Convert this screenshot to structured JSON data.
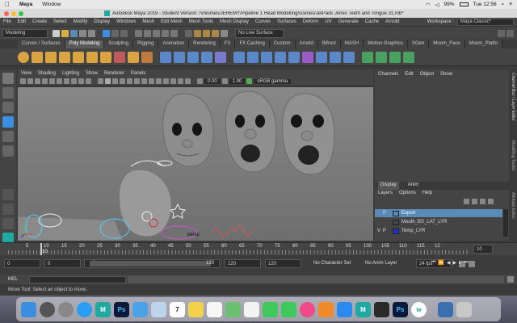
{
  "mac_menubar": {
    "apple": "",
    "app": "Maya",
    "window": "Window",
    "status_pct": "99%",
    "clock": "Tue 12:56"
  },
  "titlebar": {
    "title": "Autodesk Maya 2019 - Student Version: /Volumes/JEREMY/Pipeline 1 Head Modelling/scenes/JetPack Jones Teeth and Tongue 31.mb*"
  },
  "maya_menu": [
    "File",
    "Edit",
    "Create",
    "Select",
    "Modify",
    "Display",
    "Windows",
    "Mesh",
    "Edit Mesh",
    "Mesh Tools",
    "Mesh Display",
    "Curves",
    "Surfaces",
    "Deform",
    "UV",
    "Generate",
    "Cache",
    "Arnold"
  ],
  "workspace": {
    "label": "Workspace :",
    "value": "Maya Classic*"
  },
  "statusline": {
    "mode": "Modeling",
    "live_surface": "No Live Surface"
  },
  "shelf_tabs": [
    "Curves / Surfaces",
    "Poly Modeling",
    "Sculpting",
    "Rigging",
    "Animation",
    "Rendering",
    "FX",
    "FX Caching",
    "Custom",
    "Arnold",
    "Bifrost",
    "MASH",
    "Motion Graphics",
    "XGen",
    "Moom_Face",
    "Moom_Platfo"
  ],
  "active_shelf": "Poly Modeling",
  "panel_menu": [
    "View",
    "Shading",
    "Lighting",
    "Show",
    "Renderer",
    "Panels"
  ],
  "panel_toolbar": {
    "val1": "0.00",
    "val2": "1.00",
    "colorspace": "sRGB gamma"
  },
  "viewport": {
    "camera": "persp"
  },
  "channel_box": {
    "menu": [
      "Channels",
      "Edit",
      "Object",
      "Show"
    ]
  },
  "vert_tabs": {
    "tab1": "Channel Box / Layer Editor",
    "tab2": "Modelling Toolkit",
    "tab3": "Attribute Editor"
  },
  "layer_editor": {
    "tabs": [
      "Display",
      "Anim"
    ],
    "menu": [
      "Layers",
      "Options",
      "Help"
    ],
    "layers": [
      {
        "v": "",
        "p": "P",
        "name": "Export",
        "color": "#5a8ab8"
      },
      {
        "v": "",
        "p": "",
        "name": "Mouth_BS_LAT_LYR",
        "color": "#444444"
      },
      {
        "v": "V",
        "p": "P",
        "name": "Temp_LYR",
        "color": "#1a33cc"
      }
    ]
  },
  "timeslider": {
    "ticks": [
      "5",
      "10",
      "15",
      "20",
      "25",
      "30",
      "35",
      "40",
      "45",
      "50",
      "55",
      "60",
      "65",
      "70",
      "75",
      "80",
      "85",
      "90",
      "95",
      "100",
      "105",
      "110",
      "115",
      "12"
    ],
    "current_frame": "10",
    "current_marker": "10"
  },
  "rangeslider": {
    "start": "0",
    "start2": "0",
    "range_start": "0",
    "range_end": "120",
    "end": "120",
    "end2": "120",
    "character_set": "No Character Set",
    "anim_layer": "No Anim Layer",
    "fps": "24 fps"
  },
  "cmdline": {
    "label": "MEL"
  },
  "helpline": {
    "text": "Move Tool: Select an object to move."
  },
  "dock": {
    "icons": [
      {
        "name": "finder",
        "color": "#3b8fe0",
        "text": ""
      },
      {
        "name": "launchpad",
        "color": "#555",
        "text": ""
      },
      {
        "name": "system-prefs",
        "color": "#888",
        "text": ""
      },
      {
        "name": "safari",
        "color": "#2a9df4",
        "text": ""
      },
      {
        "name": "maya",
        "color": "#1fa9a0",
        "text": "M"
      },
      {
        "name": "photoshop",
        "color": "#0b1a3a",
        "text": "Ps"
      },
      {
        "name": "mail",
        "color": "#4aa3e8",
        "text": ""
      },
      {
        "name": "preview",
        "color": "#bcd4ee",
        "text": ""
      },
      {
        "name": "calendar",
        "color": "#ffffff",
        "text": "7"
      },
      {
        "name": "notes",
        "color": "#f3d24a",
        "text": ""
      },
      {
        "name": "reminders",
        "color": "#f6f6f6",
        "text": ""
      },
      {
        "name": "maps",
        "color": "#6cc070",
        "text": ""
      },
      {
        "name": "photos",
        "color": "#f4f4f4",
        "text": ""
      },
      {
        "name": "messages",
        "color": "#3ec95a",
        "text": ""
      },
      {
        "name": "facetime",
        "color": "#3ec95a",
        "text": ""
      },
      {
        "name": "itunes",
        "color": "#f04a8a",
        "text": ""
      },
      {
        "name": "ibooks",
        "color": "#f08a2a",
        "text": ""
      },
      {
        "name": "app-store",
        "color": "#2a8af0",
        "text": ""
      },
      {
        "name": "maya2",
        "color": "#1fa9a0",
        "text": "M"
      },
      {
        "name": "app-dark",
        "color": "#2a2a2a",
        "text": ""
      },
      {
        "name": "photoshop2",
        "color": "#0b1a3a",
        "text": "Ps"
      },
      {
        "name": "webex",
        "color": "#ffffff",
        "text": "w"
      },
      {
        "name": "downloads",
        "color": "#3b6fb0",
        "text": ""
      },
      {
        "name": "trash",
        "color": "#c8c8c8",
        "text": ""
      }
    ]
  }
}
